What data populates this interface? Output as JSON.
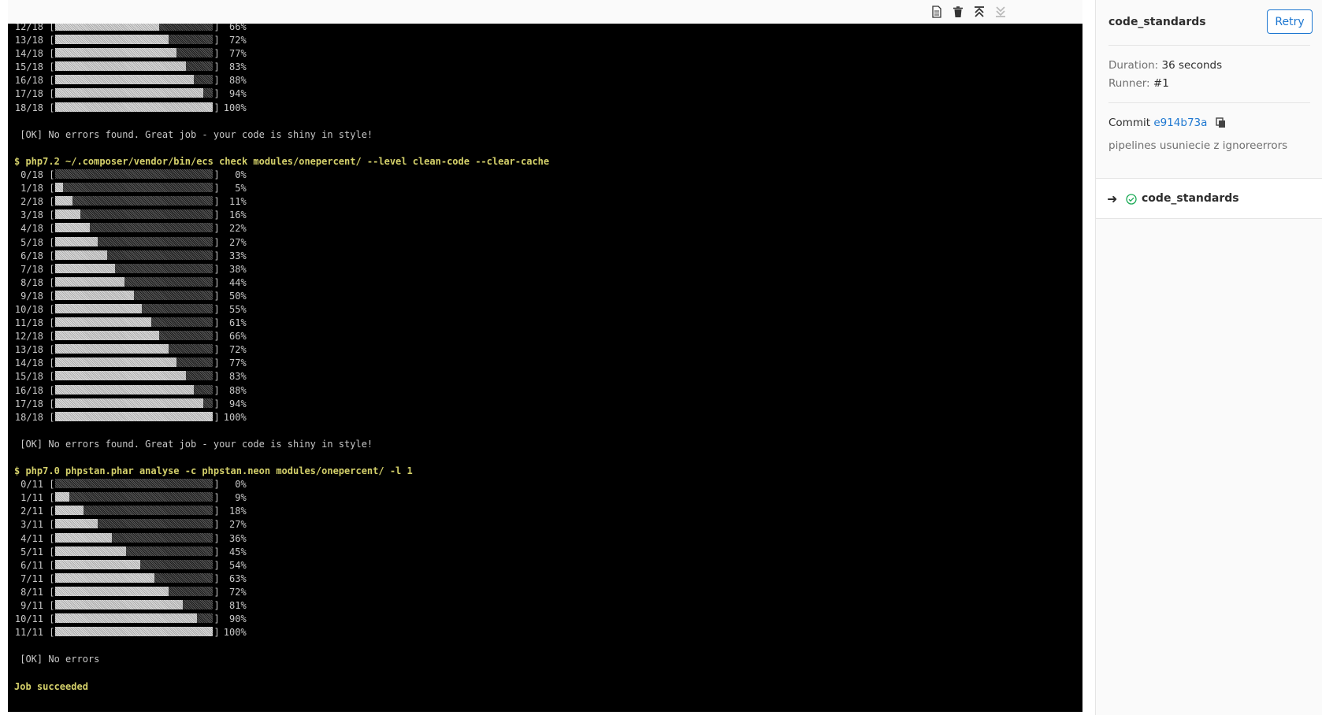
{
  "toolbar": {
    "buttons": [
      {
        "name": "raw-log-icon"
      },
      {
        "name": "erase-log-icon"
      },
      {
        "name": "scroll-top-icon"
      },
      {
        "name": "scroll-bottom-icon"
      }
    ]
  },
  "terminal": {
    "lines": [
      {
        "type": "progress",
        "label": "12/18",
        "percent": "66%",
        "fill": 0.66
      },
      {
        "type": "progress",
        "label": "13/18",
        "percent": "72%",
        "fill": 0.72
      },
      {
        "type": "progress",
        "label": "14/18",
        "percent": "77%",
        "fill": 0.77
      },
      {
        "type": "progress",
        "label": "15/18",
        "percent": "83%",
        "fill": 0.83
      },
      {
        "type": "progress",
        "label": "16/18",
        "percent": "88%",
        "fill": 0.88
      },
      {
        "type": "progress",
        "label": "17/18",
        "percent": "94%",
        "fill": 0.94
      },
      {
        "type": "progress",
        "label": "18/18",
        "percent": "100%",
        "fill": 1.0
      },
      {
        "type": "blank",
        "text": ""
      },
      {
        "type": "text",
        "text": " [OK] No errors found. Great job - your code is shiny in style!"
      },
      {
        "type": "blank",
        "text": ""
      },
      {
        "type": "cmd",
        "text": "$ php7.2 ~/.composer/vendor/bin/ecs check modules/onepercent/ --level clean-code --clear-cache"
      },
      {
        "type": "progress",
        "label": "0/18",
        "percent": "0%",
        "fill": 0.0
      },
      {
        "type": "progress",
        "label": "1/18",
        "percent": "5%",
        "fill": 0.05
      },
      {
        "type": "progress",
        "label": "2/18",
        "percent": "11%",
        "fill": 0.11
      },
      {
        "type": "progress",
        "label": "3/18",
        "percent": "16%",
        "fill": 0.16
      },
      {
        "type": "progress",
        "label": "4/18",
        "percent": "22%",
        "fill": 0.22
      },
      {
        "type": "progress",
        "label": "5/18",
        "percent": "27%",
        "fill": 0.27
      },
      {
        "type": "progress",
        "label": "6/18",
        "percent": "33%",
        "fill": 0.33
      },
      {
        "type": "progress",
        "label": "7/18",
        "percent": "38%",
        "fill": 0.38
      },
      {
        "type": "progress",
        "label": "8/18",
        "percent": "44%",
        "fill": 0.44
      },
      {
        "type": "progress",
        "label": "9/18",
        "percent": "50%",
        "fill": 0.5
      },
      {
        "type": "progress",
        "label": "10/18",
        "percent": "55%",
        "fill": 0.55
      },
      {
        "type": "progress",
        "label": "11/18",
        "percent": "61%",
        "fill": 0.61
      },
      {
        "type": "progress",
        "label": "12/18",
        "percent": "66%",
        "fill": 0.66
      },
      {
        "type": "progress",
        "label": "13/18",
        "percent": "72%",
        "fill": 0.72
      },
      {
        "type": "progress",
        "label": "14/18",
        "percent": "77%",
        "fill": 0.77
      },
      {
        "type": "progress",
        "label": "15/18",
        "percent": "83%",
        "fill": 0.83
      },
      {
        "type": "progress",
        "label": "16/18",
        "percent": "88%",
        "fill": 0.88
      },
      {
        "type": "progress",
        "label": "17/18",
        "percent": "94%",
        "fill": 0.94
      },
      {
        "type": "progress",
        "label": "18/18",
        "percent": "100%",
        "fill": 1.0
      },
      {
        "type": "blank",
        "text": ""
      },
      {
        "type": "text",
        "text": " [OK] No errors found. Great job - your code is shiny in style!"
      },
      {
        "type": "blank",
        "text": ""
      },
      {
        "type": "cmd",
        "text": "$ php7.0 phpstan.phar analyse -c phpstan.neon modules/onepercent/ -l 1"
      },
      {
        "type": "progress",
        "label": "0/11",
        "percent": "0%",
        "fill": 0.0
      },
      {
        "type": "progress",
        "label": "1/11",
        "percent": "9%",
        "fill": 0.09
      },
      {
        "type": "progress",
        "label": "2/11",
        "percent": "18%",
        "fill": 0.18
      },
      {
        "type": "progress",
        "label": "3/11",
        "percent": "27%",
        "fill": 0.27
      },
      {
        "type": "progress",
        "label": "4/11",
        "percent": "36%",
        "fill": 0.36
      },
      {
        "type": "progress",
        "label": "5/11",
        "percent": "45%",
        "fill": 0.45
      },
      {
        "type": "progress",
        "label": "6/11",
        "percent": "54%",
        "fill": 0.54
      },
      {
        "type": "progress",
        "label": "7/11",
        "percent": "63%",
        "fill": 0.63
      },
      {
        "type": "progress",
        "label": "8/11",
        "percent": "72%",
        "fill": 0.72
      },
      {
        "type": "progress",
        "label": "9/11",
        "percent": "81%",
        "fill": 0.81
      },
      {
        "type": "progress",
        "label": "10/11",
        "percent": "90%",
        "fill": 0.9
      },
      {
        "type": "progress",
        "label": "11/11",
        "percent": "100%",
        "fill": 1.0
      },
      {
        "type": "blank",
        "text": ""
      },
      {
        "type": "text",
        "text": " [OK] No errors"
      },
      {
        "type": "blank",
        "text": ""
      },
      {
        "type": "cmd",
        "text": "Job succeeded"
      }
    ]
  },
  "sidebar": {
    "job_title": "code_standards",
    "retry_label": "Retry",
    "duration_label": "Duration:",
    "duration_value": "36 seconds",
    "runner_label": "Runner:",
    "runner_value": "#1",
    "commit_label": "Commit",
    "commit_sha": "e914b73a",
    "commit_message": "pipelines usuniecie z ignoreerrors",
    "job_list": [
      {
        "name": "code_standards",
        "status": "success",
        "current": true
      }
    ]
  },
  "colors": {
    "accent": "#1f78d1",
    "success": "#1aaa55",
    "terminal_bg": "#000000",
    "command": "#d4d06a"
  }
}
